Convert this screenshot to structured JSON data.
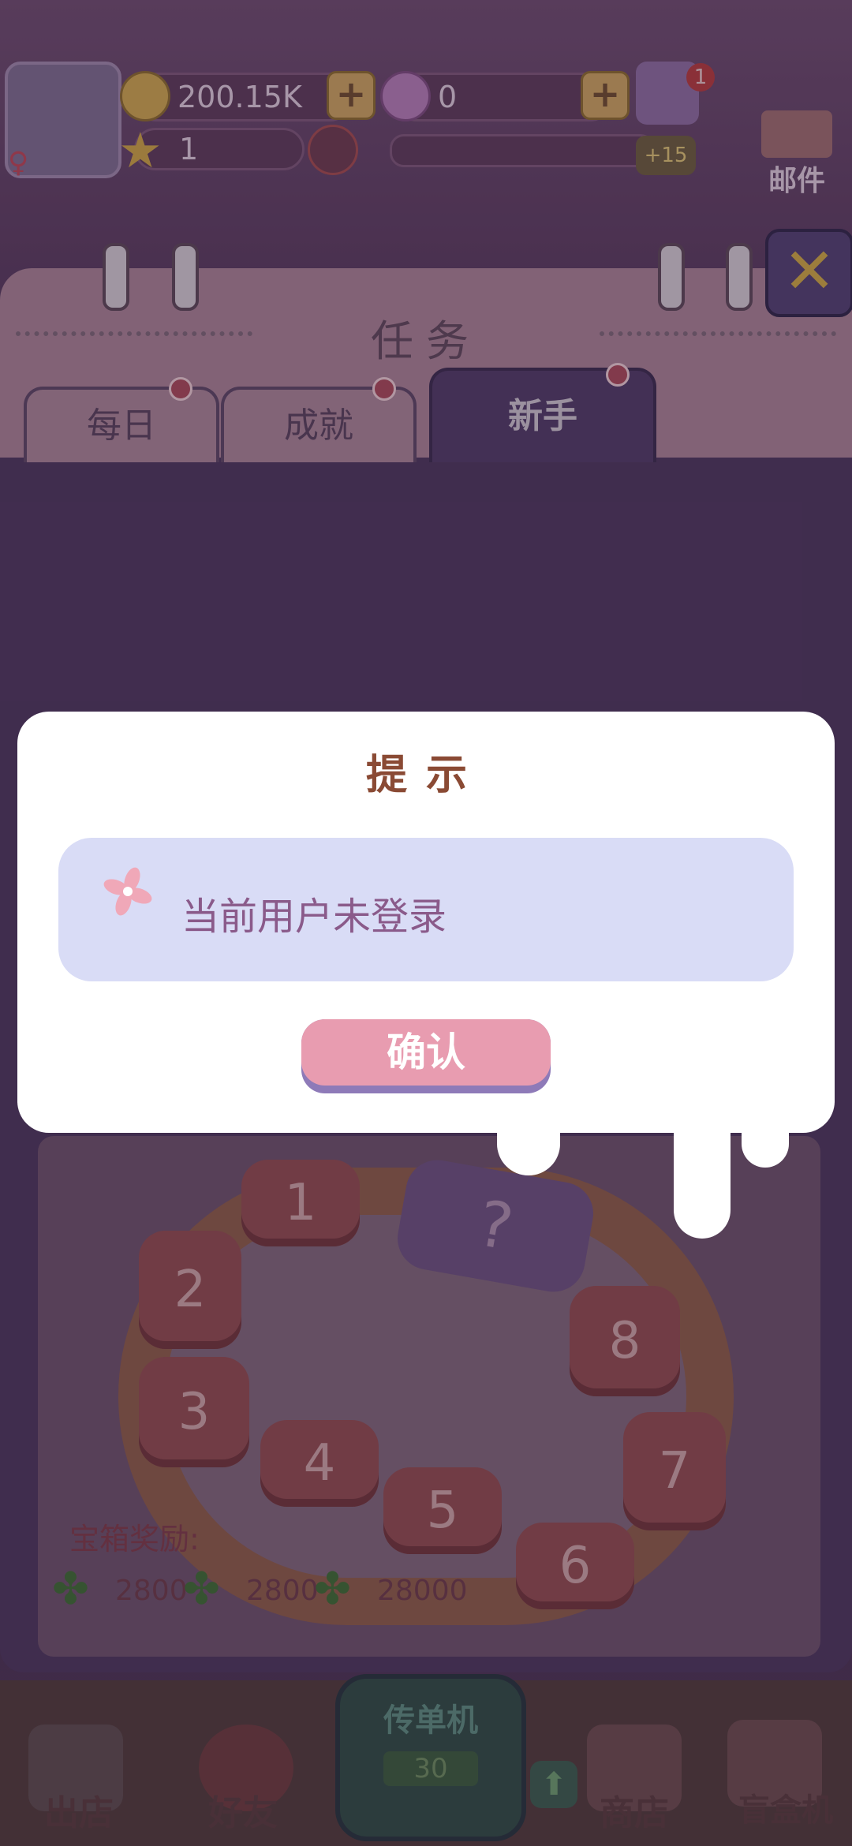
{
  "hud": {
    "coins": "200.15K",
    "crowns": "0",
    "level": "1",
    "xp_bonus": "+15",
    "notification_count": "1",
    "mail_label": "邮件"
  },
  "panel": {
    "title": "任务",
    "tabs": [
      {
        "label": "每日",
        "active": false
      },
      {
        "label": "成就",
        "active": false
      },
      {
        "label": "新手",
        "active": true
      }
    ]
  },
  "board": {
    "tiles": [
      "1",
      "2",
      "3",
      "4",
      "5",
      "6",
      "7",
      "8"
    ],
    "mystery_tile": "?",
    "reward_label": "宝箱奖励:",
    "rewards": [
      "2800",
      "2800",
      "28000"
    ]
  },
  "bottom_nav": {
    "items": [
      "出店",
      "好友",
      "商店",
      "盲盒机"
    ],
    "flyer_machine_label": "传单机",
    "flyer_count": "30"
  },
  "dialog": {
    "title": "提示",
    "message": "当前用户未登录",
    "confirm_label": "确认"
  },
  "colors": {
    "dialog_bg": "#ffffff",
    "message_box": "#d9dcf6",
    "confirm_button": "#e89cb0",
    "title_text": "#8a4a34"
  }
}
